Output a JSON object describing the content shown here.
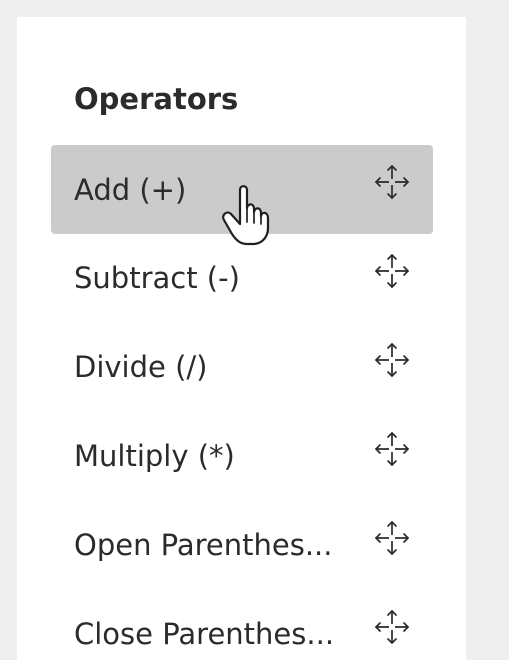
{
  "panel": {
    "title": "Operators"
  },
  "operators": [
    {
      "label": "Add (+)",
      "hovered": true,
      "icon": "move-icon"
    },
    {
      "label": "Subtract (-)",
      "hovered": false,
      "icon": "move-icon"
    },
    {
      "label": "Divide (/)",
      "hovered": false,
      "icon": "move-icon"
    },
    {
      "label": "Multiply (*)",
      "hovered": false,
      "icon": "move-icon"
    },
    {
      "label": "Open Parenthes...",
      "hovered": false,
      "icon": "move-icon"
    },
    {
      "label": "Close Parenthes...",
      "hovered": false,
      "icon": "move-icon"
    }
  ],
  "colors": {
    "background": "#efefef",
    "panel": "#ffffff",
    "hover": "#cbcbcb",
    "text": "#2b2b2b"
  },
  "cursor": {
    "icon": "hand-pointer-cursor-icon"
  }
}
